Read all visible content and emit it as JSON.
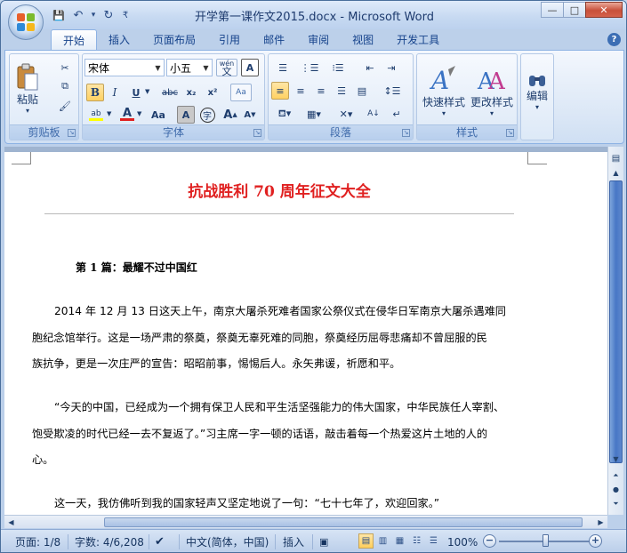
{
  "window": {
    "title": "开学第一课作文2015.docx - Microsoft Word",
    "controls": {
      "minimize": "—",
      "maximize": "□",
      "close": "✕"
    }
  },
  "quick_access": {
    "save": "💾",
    "undo": "↶",
    "undo_dd": "▾",
    "redo": "↻",
    "customize": "₹"
  },
  "ribbon": {
    "tabs": [
      "开始",
      "插入",
      "页面布局",
      "引用",
      "邮件",
      "审阅",
      "视图",
      "开发工具"
    ],
    "active_tab": "开始",
    "help": "?",
    "clipboard": {
      "label": "剪贴板",
      "paste": "粘贴"
    },
    "font": {
      "label": "字体",
      "font_name": "宋体",
      "font_size": "小五",
      "wen": "wén",
      "wen_char": "文",
      "A_box": "A",
      "bold": "B",
      "italic": "I",
      "underline": "U",
      "strike": "abc",
      "sub": "x₂",
      "sup": "x²",
      "clear": "Aa",
      "change_case": "Aa",
      "char_shading": "A",
      "enclose": "字",
      "grow": "A",
      "shrink": "A",
      "highlight": "ab",
      "color": "A",
      "pinyin": "ab"
    },
    "paragraph": {
      "label": "段落",
      "sort": "A↓",
      "marks": "↵"
    },
    "styles": {
      "label": "样式",
      "quick_styles": "快速样式",
      "change_styles": "更改样式"
    },
    "editing": {
      "label": "编辑"
    }
  },
  "document": {
    "title": "抗战胜利 70 周年征文大全",
    "heading": "第 1 篇：最耀不过中国红",
    "paragraphs": [
      [
        "2014 年 12 月 13 日这天上午，南京大屠杀死难者国家公祭仪式在侵华日军南京大屠杀遇难同",
        "胞纪念馆举行。这是一场严肃的祭奠，祭奠无辜死难的同胞，祭奠经历屈辱悲痛却不曾屈服的民",
        "族抗争，更是一次庄严的宣告：昭昭前事，惕惕后人。永矢弗谖，祈愿和平。"
      ],
      [
        "“今天的中国，已经成为一个拥有保卫人民和平生活坚强能力的伟大国家，中华民族任人宰割、",
        "饱受欺凌的时代已经一去不复返了。”习主席一字一顿的话语，敲击着每一个热爱这片土地的人的",
        "心。"
      ],
      [
        "这一天，我仿佛听到我的国家轻声又坚定地说了一句：“七十七年了，欢迎回家。”"
      ]
    ]
  },
  "statusbar": {
    "page": "页面: 1/8",
    "words": "字数: 4/6,208",
    "language": "中文(简体，中国)",
    "mode": "插入",
    "zoom": "100%",
    "zoom_level": 0.5,
    "zoom_out": "−",
    "zoom_in": "+"
  }
}
